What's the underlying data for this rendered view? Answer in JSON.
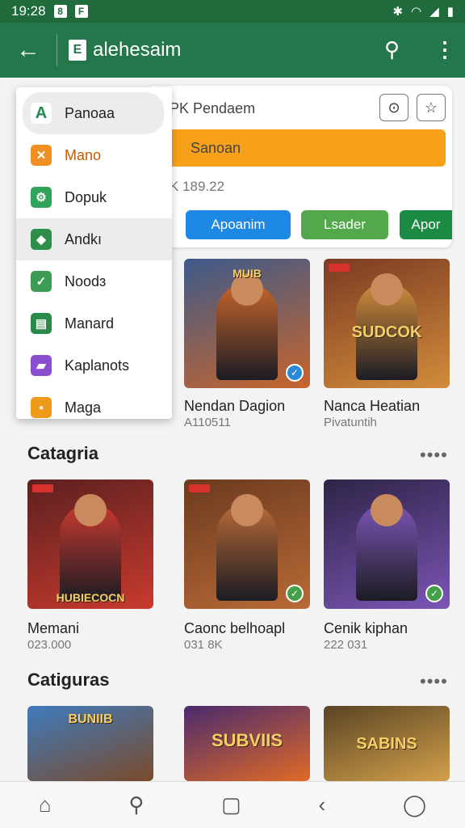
{
  "status": {
    "time": "19:28",
    "icons": [
      "8",
      "F"
    ],
    "right_icons": [
      "✱",
      "◠",
      "◢",
      "▮"
    ]
  },
  "appbar": {
    "title": "alehesaim",
    "logo": "E"
  },
  "card": {
    "title": "PK Pendaem",
    "orange_label": "Sanoan",
    "subline": "K 189.22",
    "pills": [
      "Apoanim",
      "Lsader",
      "Apor"
    ]
  },
  "menu": {
    "items": [
      {
        "label": "Panoaa",
        "icon": "A",
        "color": "#1f8a4c"
      },
      {
        "label": "Mano",
        "icon": "✕",
        "color": "#f19022"
      },
      {
        "label": "Dopuk",
        "icon": "⚙",
        "color": "#31a35a"
      },
      {
        "label": "Andkı",
        "icon": "◆",
        "color": "#2f8f4a"
      },
      {
        "label": "Noodɜ",
        "icon": "✓",
        "color": "#3c9b55"
      },
      {
        "label": "Manard",
        "icon": "▤",
        "color": "#2a8a47"
      },
      {
        "label": "Kaplanots",
        "icon": "▰",
        "color": "#8a4fd1"
      },
      {
        "label": "Maga",
        "icon": "▪",
        "color": "#f09a1c"
      }
    ]
  },
  "row1": [
    {
      "name": "Nendan Dagion",
      "meta": "A110511",
      "art": "MUIB",
      "c1": "#3d5a8a",
      "c2": "#c8652b"
    },
    {
      "name": "Nanca Heatian",
      "meta": "Pivatuntih",
      "art": "SUDCOK",
      "c1": "#7a3b22",
      "c2": "#d38c3b"
    }
  ],
  "sections": [
    {
      "title": "Catagria"
    },
    {
      "title": "Catiguras"
    }
  ],
  "row2": [
    {
      "name": "Memani",
      "meta": "023.000",
      "art": "HUBIECOCN",
      "c1": "#5b2020",
      "c2": "#c93a2e"
    },
    {
      "name": "Caonc belhoapl",
      "meta": "031 8K",
      "art": "",
      "c1": "#6b3a1f",
      "c2": "#b96a36"
    },
    {
      "name": "Cenik kiphan",
      "meta": "222 031",
      "art": "",
      "c1": "#2e2447",
      "c2": "#7b55b5"
    }
  ],
  "row3": [
    {
      "art": "BUNIIB",
      "c1": "#3f7bbd",
      "c2": "#7a4a2a"
    },
    {
      "art": "SUBVIIS",
      "c1": "#4a2a6e",
      "c2": "#e06a26"
    },
    {
      "art": "SABINS",
      "c1": "#5a4424",
      "c2": "#d2a04a"
    }
  ],
  "bottomnav": {
    "icons": [
      "⌂",
      "⚲",
      "▢",
      "‹",
      "◯"
    ]
  }
}
